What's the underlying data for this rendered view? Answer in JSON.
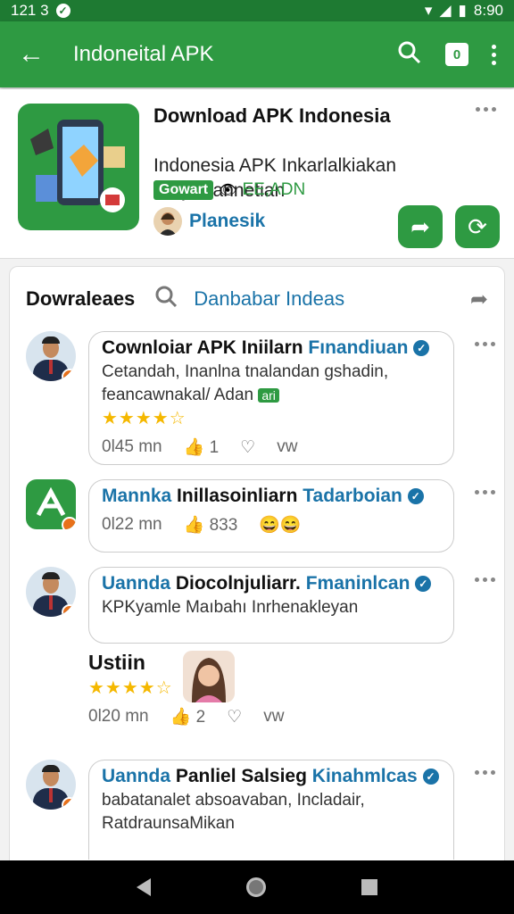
{
  "status": {
    "time_left": "121 3",
    "time_right": "8:90"
  },
  "appbar": {
    "title": "Indoneital APK",
    "badge": "0"
  },
  "app": {
    "title": "Download APK Indonesia",
    "subtitle_line1": "Indonesia APK Inkarlalkiakan",
    "subtitle_line2": "alnijantannetian",
    "tag": "Gowart",
    "tag_text": "EE,ADN",
    "publisher": "Planesik"
  },
  "card": {
    "label": "Dowraleaes",
    "link": "Danbabar Indeas"
  },
  "posts": [
    {
      "title": "Cownloiar APK Iniilarn",
      "title_blue": "Fınandiuan",
      "line1": "Cetandah, Inanlna tnalandan gshadin,",
      "line2": "feancawnakal/ Adan",
      "mini_tag": "ari",
      "stars": "★★★★☆",
      "time": "0l45 mn",
      "likes": "1",
      "extra": "vw"
    },
    {
      "title_blue_prefix": "Mannka",
      "title": "Inillasoinliarn",
      "title_blue": "Tadarboian",
      "time": "0l22 mn",
      "likes": "833"
    },
    {
      "title_blue_prefix": "Uannda",
      "title": "Diocolnjuliarr.",
      "title_blue": "Fmaninlcan",
      "line1": "KPKyamle Maıbahı Inrhenakleyan"
    },
    {
      "title": "Ustiin",
      "stars": "★★★★☆",
      "time": "0l20 mn",
      "likes": "2",
      "extra": "vw"
    },
    {
      "title_blue_prefix": "Uannda",
      "title": "Panliel Salsieg",
      "title_blue": "Kinahmlcas",
      "line1": "babatanalet absoavaban, Incladair,",
      "line2": "RatdraunsaMikan"
    }
  ]
}
